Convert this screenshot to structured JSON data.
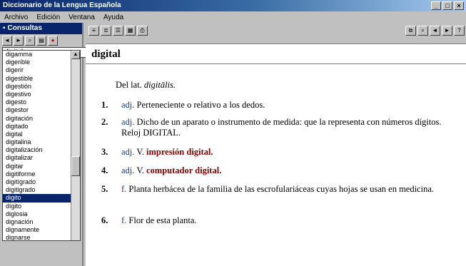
{
  "window": {
    "title": "Diccionario de la Lengua Española",
    "buttons": [
      "_",
      "□",
      "×"
    ]
  },
  "menu": [
    "Archivo",
    "Edición",
    "Ventana",
    "Ayuda"
  ],
  "sidebar": {
    "header_title": "Consultas",
    "toolbar_icons": [
      "back-icon",
      "forward-icon",
      "search-icon",
      "print-icon",
      "stop-icon"
    ],
    "search_value": "digital",
    "words": [
      "digamma",
      "digerible",
      "digerir",
      "digestible",
      "digestión",
      "digestivo",
      "digesto",
      "digestor",
      "digitación",
      "digitado",
      "digital",
      "digitalina",
      "digitalización",
      "digitalizar",
      "digitar",
      "digitiforme",
      "digitígrado",
      "digitigrado",
      "digito",
      "dígito",
      "diglosia",
      "dignación",
      "dignamente",
      "dignarse"
    ],
    "selected_index": 18
  },
  "content": {
    "toolbar_left": [
      "view-icon",
      "view-icon",
      "view-icon",
      "view-icon",
      "print-icon"
    ],
    "toolbar_right": [
      "copy-icon",
      "find-icon",
      "prev-icon",
      "next-icon",
      "help-icon"
    ],
    "headword": "digital",
    "etymology": {
      "label": "Del lat.",
      "origin": "digitālis."
    },
    "senses": [
      {
        "num": "1.",
        "tag": "adj.",
        "text": "Perteneciente o relativo a los dedos."
      },
      {
        "num": "2.",
        "tag": "adj.",
        "text": "Dicho de un aparato o instrumento de medida: que la representa con números dígitos. Reloj DIGITAL."
      },
      {
        "num": "3.",
        "tag": "adj.",
        "ref": "V.",
        "link": "impresión digital."
      },
      {
        "num": "4.",
        "tag": "adj.",
        "ref": "V.",
        "link": "computador digital."
      },
      {
        "num": "5.",
        "tag": "f.",
        "text": "Planta herbácea de la familia de las escrofulariáceas cuyas hojas se usan en medicina."
      },
      {
        "num": "6.",
        "tag": "f.",
        "text": "Flor de esta planta."
      }
    ]
  }
}
